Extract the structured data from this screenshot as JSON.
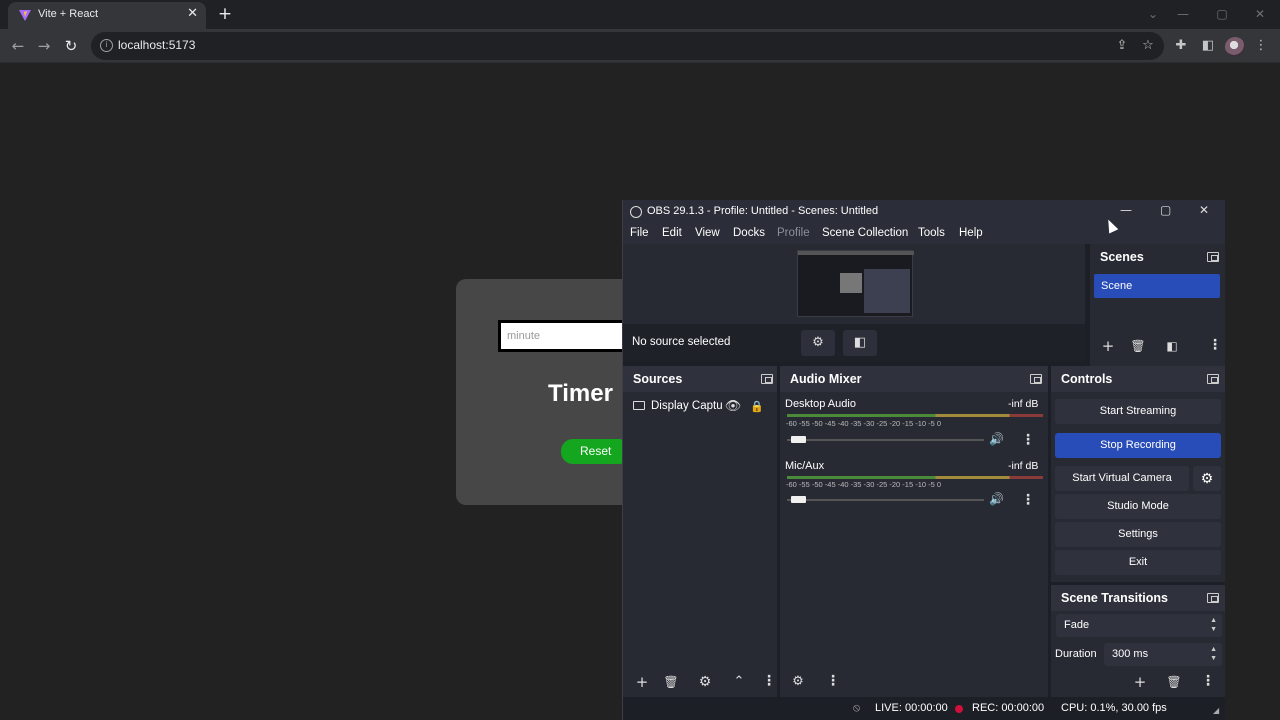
{
  "browser": {
    "tab_title": "Vite + React",
    "url": "localhost:5173",
    "tab_close": "✕",
    "new_tab": "+"
  },
  "webapp": {
    "input_placeholder": "minute",
    "title": "Timer",
    "reset_label": "Reset"
  },
  "obs": {
    "window_title": "OBS 29.1.3 - Profile: Untitled - Scenes: Untitled",
    "menu": [
      "File",
      "Edit",
      "View",
      "Docks",
      "Profile",
      "Scene Collection",
      "Tools",
      "Help"
    ],
    "no_source": "No source selected",
    "scenes": {
      "title": "Scenes",
      "items": [
        "Scene"
      ]
    },
    "sources": {
      "title": "Sources",
      "items": [
        "Display Captu"
      ]
    },
    "mixer": {
      "title": "Audio Mixer",
      "ticks": "-60 -55 -50 -45 -40 -35 -30 -25 -20 -15 -10 -5 0",
      "channels": [
        {
          "name": "Desktop Audio",
          "db": "-inf dB"
        },
        {
          "name": "Mic/Aux",
          "db": "-inf dB"
        }
      ]
    },
    "controls": {
      "title": "Controls",
      "start_streaming": "Start Streaming",
      "stop_recording": "Stop Recording",
      "start_virtual_camera": "Start Virtual Camera",
      "studio_mode": "Studio Mode",
      "settings": "Settings",
      "exit": "Exit"
    },
    "transitions": {
      "title": "Scene Transitions",
      "selected": "Fade",
      "duration_label": "Duration",
      "duration_value": "300 ms"
    },
    "status": {
      "live": "LIVE: 00:00:00",
      "rec": "REC: 00:00:00",
      "cpu": "CPU: 0.1%, 30.00 fps"
    }
  },
  "colors": {
    "accent": "#284cb8",
    "reset_green": "#15a61f",
    "rec_red": "#d0103a"
  }
}
